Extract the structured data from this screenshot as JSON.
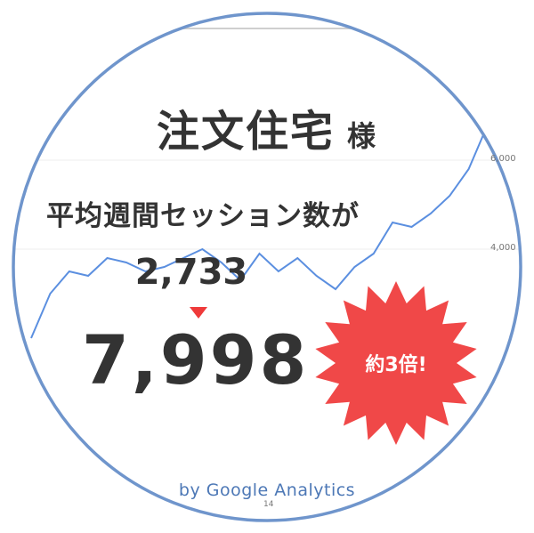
{
  "title": {
    "main": "注文住宅",
    "suffix": "様"
  },
  "subtitle": "平均週間セッション数が",
  "before_value": "2,733",
  "after_value": "7,998",
  "badge": "約3倍!",
  "byline": "by Google Analytics",
  "colors": {
    "line": "#5b8fe0",
    "circle": "#6f95cc",
    "arrow": "#ef3a3a",
    "burst": "#f04848",
    "text": "#333333"
  },
  "chart_data": {
    "type": "line",
    "x": [
      1,
      2,
      3,
      4,
      5,
      6,
      7,
      8,
      9,
      10,
      11,
      12,
      13,
      14,
      15,
      16,
      17,
      18,
      19,
      20,
      21,
      22,
      23,
      24,
      25
    ],
    "values": [
      2000,
      3000,
      3500,
      3400,
      3800,
      3700,
      3500,
      3600,
      3800,
      4000,
      3700,
      3300,
      3900,
      3500,
      3800,
      3400,
      3100,
      3600,
      3900,
      4600,
      4500,
      4800,
      5200,
      5800,
      6800
    ],
    "ylim": [
      1200,
      6800
    ],
    "y_ticks": [
      {
        "value": 4000,
        "label": "4,000"
      },
      {
        "value": 6000,
        "label": "6,000"
      }
    ],
    "x_tick_labels": [
      "14"
    ],
    "grid": true
  }
}
